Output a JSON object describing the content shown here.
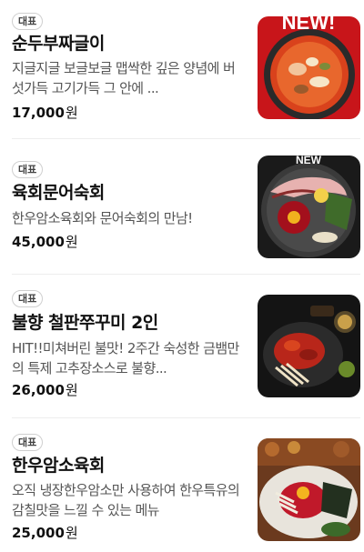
{
  "menu": {
    "items": [
      {
        "badge": "대표",
        "name": "순두부짜글이",
        "description": "지글지글 보글보글 맵싹한 깊은 양념에 버섯가득 고기가득 그 안에 ...",
        "price": "17,000",
        "currency": "원",
        "image": "sundubu-jjageuli-photo",
        "image_text": "NEW!"
      },
      {
        "badge": "대표",
        "name": "육회문어숙회",
        "description": "한우암소육회와 문어숙회의 만남!",
        "price": "45,000",
        "currency": "원",
        "image": "yukhoe-octopus-photo",
        "image_text": "NEW"
      },
      {
        "badge": "대표",
        "name": "불향 철판쭈꾸미 2인",
        "description": "HIT!!미쳐버린 불맛! 2주간 숙성한 금뱀만의 특제 고추장소스로 불향...",
        "price": "26,000",
        "currency": "원",
        "image": "jjukkumi-iron-plate-photo"
      },
      {
        "badge": "대표",
        "name": "한우암소육회",
        "description": "오직 냉장한우암소만 사용하여 한우특유의 감칠맛을 느낄 수 있는 메뉴",
        "price": "25,000",
        "currency": "원",
        "image": "hanwoo-yukhoe-photo"
      }
    ]
  }
}
